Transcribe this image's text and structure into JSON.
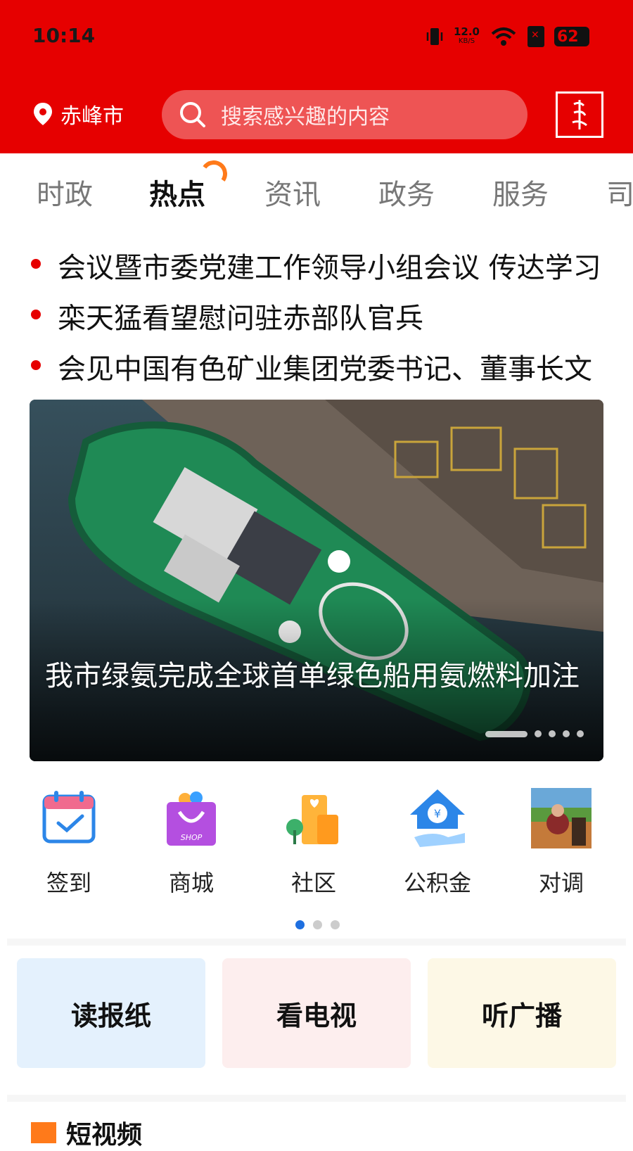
{
  "status_bar": {
    "time": "10:14",
    "speed_value": "12.0",
    "speed_unit": "KB/S",
    "battery": "62"
  },
  "header": {
    "city": "赤峰市",
    "search_placeholder": "搜索感兴趣的内容",
    "colors": {
      "brand_red": "#e60000",
      "search_bg": "#ee5454"
    }
  },
  "tabs": [
    {
      "label": "时政",
      "active": false
    },
    {
      "label": "热点",
      "active": true
    },
    {
      "label": "资讯",
      "active": false
    },
    {
      "label": "政务",
      "active": false
    },
    {
      "label": "服务",
      "active": false
    },
    {
      "label": "司",
      "active": false
    }
  ],
  "headlines": [
    "会议暨市委党建工作领导小组会议 传达学习",
    "栾天猛看望慰问驻赤部队官兵",
    "会见中国有色矿业集团党委书记、董事长文"
  ],
  "banner": {
    "title": "我市绿氨完成全球首单绿色船用氨燃料加注",
    "page_count": 5,
    "active_page": 1
  },
  "quick_actions": [
    {
      "label": "签到",
      "icon": "calendar-check-icon"
    },
    {
      "label": "商城",
      "icon": "shopping-bag-icon"
    },
    {
      "label": "社区",
      "icon": "community-building-icon"
    },
    {
      "label": "公积金",
      "icon": "housing-fund-icon"
    },
    {
      "label": "对调",
      "icon": "photo-thumbnail-icon"
    }
  ],
  "quick_pager": {
    "pages": 3,
    "active": 1,
    "accent": "#1e6fe0"
  },
  "media_cards": [
    {
      "label": "读报纸",
      "bg": "#e4f1fd"
    },
    {
      "label": "看电视",
      "bg": "#fdeeee"
    },
    {
      "label": "听广播",
      "bg": "#fdf8e6"
    }
  ],
  "section": {
    "title": "短视频"
  }
}
